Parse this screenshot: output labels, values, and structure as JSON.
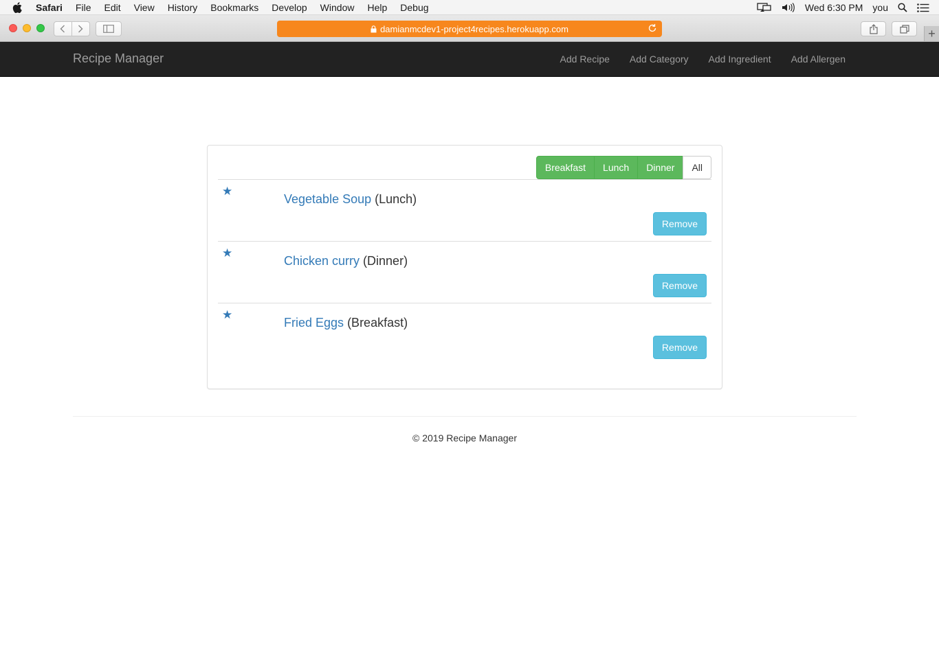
{
  "menubar": {
    "app": "Safari",
    "items": [
      "File",
      "Edit",
      "View",
      "History",
      "Bookmarks",
      "Develop",
      "Window",
      "Help",
      "Debug"
    ],
    "clock": "Wed 6:30 PM",
    "user": "you"
  },
  "browser": {
    "url": "damianmcdev1-project4recipes.herokuapp.com",
    "url_bar_color": "#f7871d"
  },
  "navbar": {
    "brand": "Recipe Manager",
    "links": [
      "Add Recipe",
      "Add Category",
      "Add Ingredient",
      "Add Allergen"
    ]
  },
  "filters": {
    "buttons": [
      "Breakfast",
      "Lunch",
      "Dinner",
      "All"
    ],
    "active_color": "#5cb85c"
  },
  "recipes": [
    {
      "name": "Vegetable Soup",
      "category": "(Lunch)",
      "remove_label": "Remove"
    },
    {
      "name": "Chicken curry",
      "category": "(Dinner)",
      "remove_label": "Remove"
    },
    {
      "name": "Fried Eggs",
      "category": "(Breakfast)",
      "remove_label": "Remove"
    }
  ],
  "footer": {
    "text": "© 2019 Recipe Manager"
  }
}
